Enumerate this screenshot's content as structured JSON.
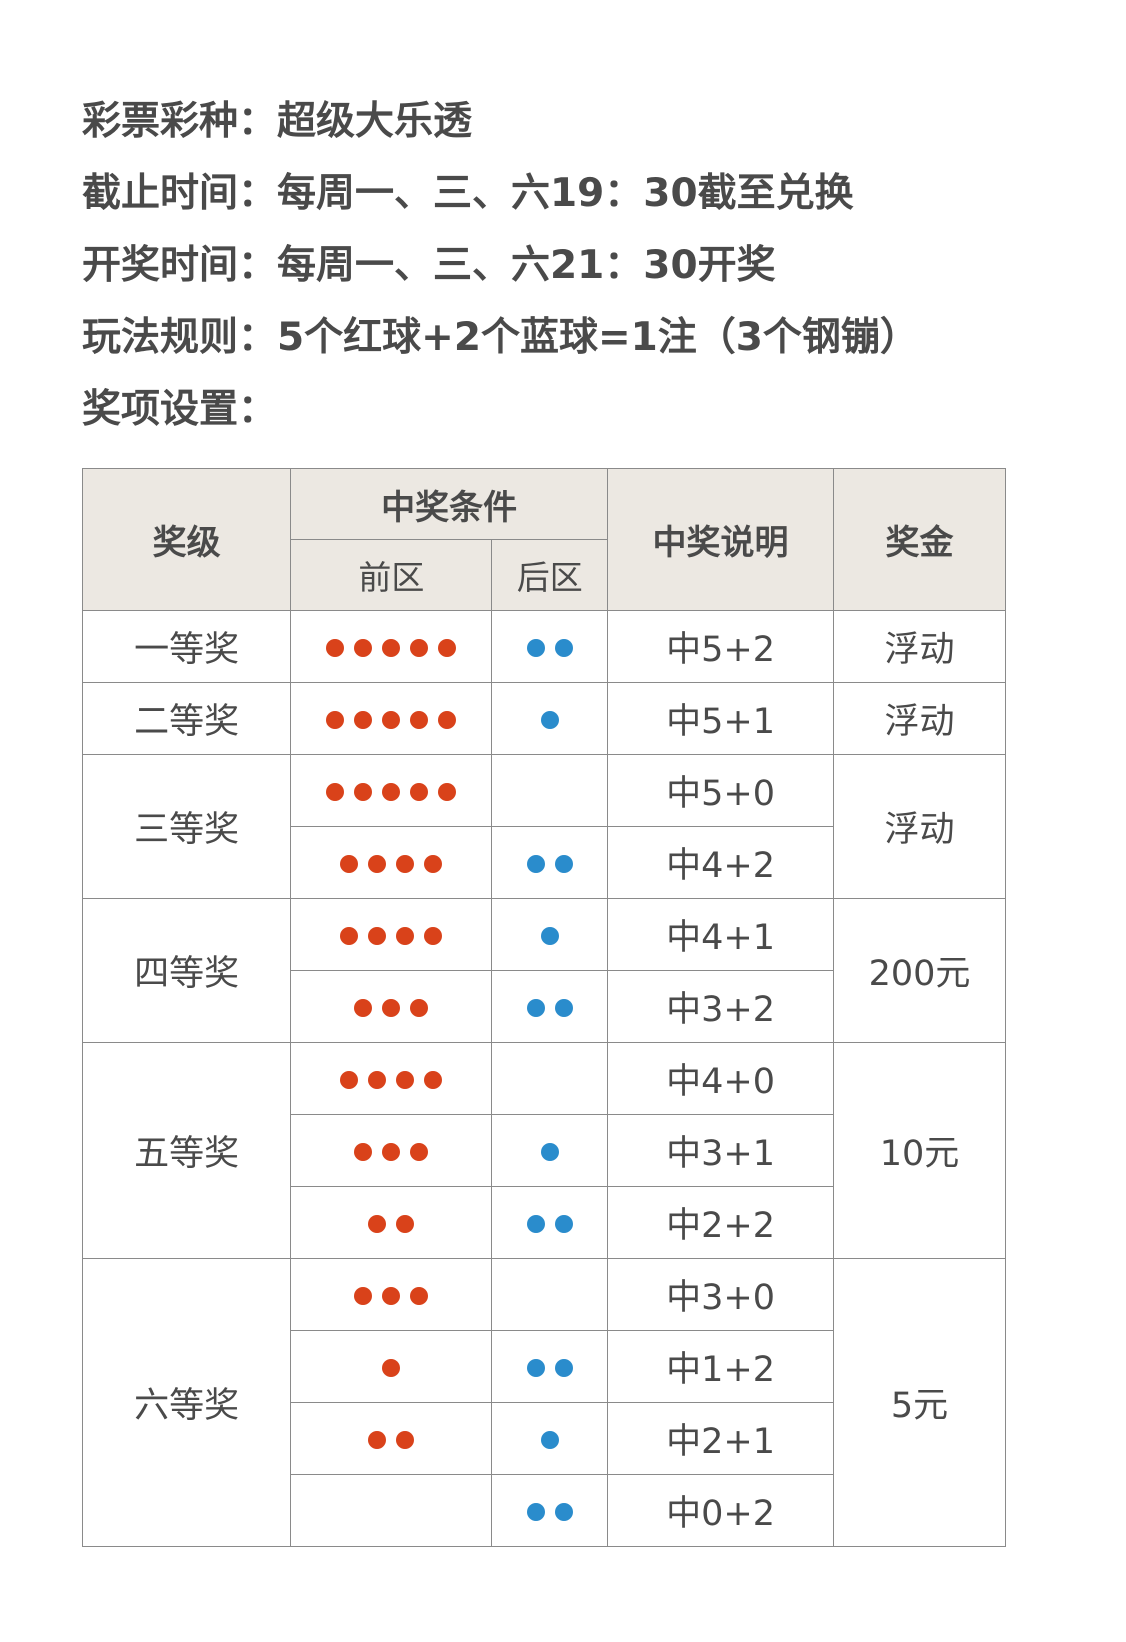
{
  "info": [
    {
      "label": "彩票彩种",
      "sep": "：",
      "value": "超级大乐透"
    },
    {
      "label": "截止时间",
      "sep": "：",
      "value": "每周一、三、六19：30截至兑换"
    },
    {
      "label": "开奖时间",
      "sep": "：",
      "value": "每周一、三、六21：30开奖"
    },
    {
      "label": "玩法规则",
      "sep": "：",
      "value": "5个红球+2个蓝球=1注（3个钢镚）"
    },
    {
      "label": "奖项设置",
      "sep": "：",
      "value": ""
    }
  ],
  "colors": {
    "red_ball": "#d9421a",
    "blue_ball": "#2a8ccc",
    "header_bg": "#ece8e2"
  },
  "table": {
    "headers": {
      "level": "奖级",
      "condition": "中奖条件",
      "front": "前区",
      "back": "后区",
      "desc": "中奖说明",
      "prize": "奖金"
    },
    "groups": [
      {
        "level": "一等奖",
        "prize": "浮动",
        "rows": [
          {
            "red": 5,
            "blue": 2,
            "desc": "中5+2"
          }
        ]
      },
      {
        "level": "二等奖",
        "prize": "浮动",
        "rows": [
          {
            "red": 5,
            "blue": 1,
            "desc": "中5+1"
          }
        ]
      },
      {
        "level": "三等奖",
        "prize": "浮动",
        "rows": [
          {
            "red": 5,
            "blue": 0,
            "desc": "中5+0"
          },
          {
            "red": 4,
            "blue": 2,
            "desc": "中4+2"
          }
        ]
      },
      {
        "level": "四等奖",
        "prize": "200元",
        "rows": [
          {
            "red": 4,
            "blue": 1,
            "desc": "中4+1"
          },
          {
            "red": 3,
            "blue": 2,
            "desc": "中3+2"
          }
        ]
      },
      {
        "level": "五等奖",
        "prize": "10元",
        "rows": [
          {
            "red": 4,
            "blue": 0,
            "desc": "中4+0"
          },
          {
            "red": 3,
            "blue": 1,
            "desc": "中3+1"
          },
          {
            "red": 2,
            "blue": 2,
            "desc": "中2+2"
          }
        ]
      },
      {
        "level": "六等奖",
        "prize": "5元",
        "rows": [
          {
            "red": 3,
            "blue": 0,
            "desc": "中3+0"
          },
          {
            "red": 1,
            "blue": 2,
            "desc": "中1+2"
          },
          {
            "red": 2,
            "blue": 1,
            "desc": "中2+1"
          },
          {
            "red": 0,
            "blue": 2,
            "desc": "中0+2"
          }
        ]
      }
    ]
  }
}
